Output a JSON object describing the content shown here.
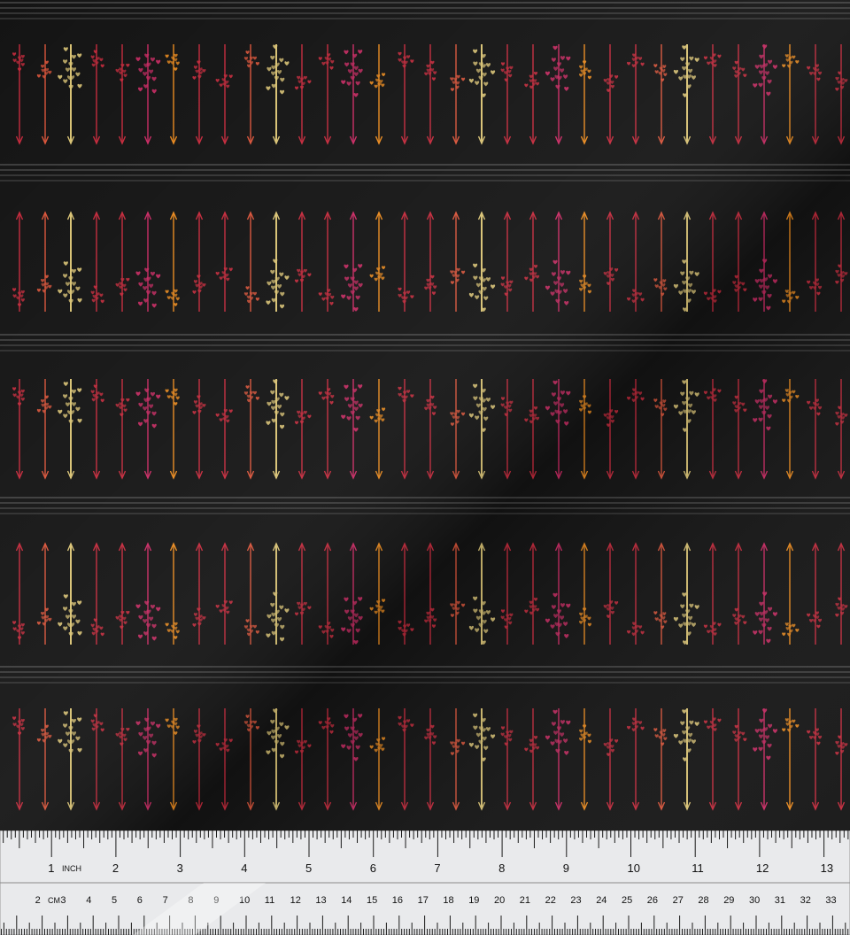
{
  "colors": {
    "background": "#141414",
    "stripe": "#4a4a4a",
    "red": "#c42a3c",
    "gold": "#d8c274",
    "orange": "#e8891e",
    "pink": "#c92a63",
    "coral": "#d8543a",
    "ruler_face": "#e9eaec",
    "ruler_ink": "#1a1a1a"
  },
  "fabric": {
    "motif": "arrows-with-heart-fletching",
    "arrow_palette": [
      "red",
      "coral",
      "gold",
      "red",
      "red",
      "pink",
      "orange",
      "red"
    ]
  },
  "ruler": {
    "inch_unit_label": "INCH",
    "cm_unit_label": "CM",
    "inch_numbers": [
      "1",
      "2",
      "3",
      "4",
      "5",
      "6",
      "7",
      "8",
      "9",
      "10",
      "11",
      "12",
      "13"
    ],
    "cm_numbers": [
      "2",
      "3",
      "4",
      "5",
      "6",
      "7",
      "8",
      "9",
      "10",
      "11",
      "12",
      "13",
      "14",
      "15",
      "16",
      "17",
      "18",
      "19",
      "20",
      "21",
      "22",
      "23",
      "24",
      "25",
      "26",
      "27",
      "28",
      "29",
      "30",
      "31",
      "32",
      "33"
    ]
  }
}
